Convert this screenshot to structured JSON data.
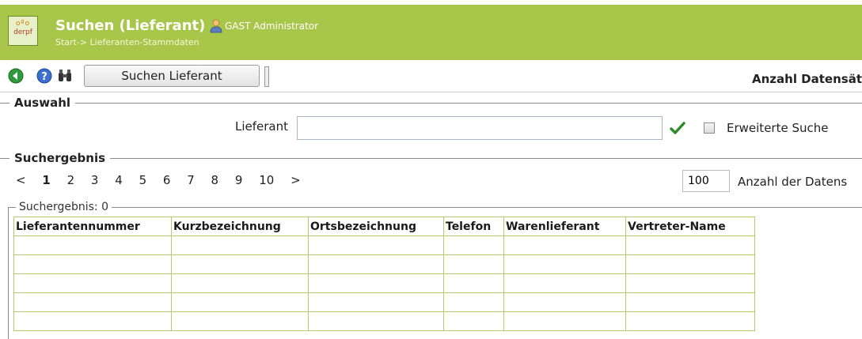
{
  "header": {
    "title": "Suchen (Lieferant)",
    "user": "GAST Administrator",
    "breadcrumb": "Start-> Lieferanten-Stammdaten",
    "logo_text": "derpf",
    "color": "#a8c64a"
  },
  "toolbar": {
    "icons": [
      "back-icon",
      "help-icon",
      "binoculars-icon"
    ],
    "search_button": "Suchen Lieferant",
    "count_label": "Anzahl Datensät"
  },
  "auswahl": {
    "title": "Auswahl",
    "field_label": "Lieferant",
    "field_value": "",
    "extended_label": "Erweiterte Suche",
    "extended_checked": false
  },
  "suchergebnis": {
    "title": "Suchergebnis",
    "pager": {
      "prev": "<",
      "pages": [
        "1",
        "2",
        "3",
        "4",
        "5",
        "6",
        "7",
        "8",
        "9",
        "10"
      ],
      "current": "1",
      "next": ">"
    },
    "per_page_value": "100",
    "per_page_label": "Anzahl der Datens",
    "results_legend": "Suchergebnis: 0",
    "columns": [
      "Lieferantennummer",
      "Kurzbezeichnung",
      "Ortsbezeichnung",
      "Telefon",
      "Warenlieferant",
      "Vertreter-Name"
    ],
    "rows": [
      [
        "",
        "",
        "",
        "",
        "",
        ""
      ],
      [
        "",
        "",
        "",
        "",
        "",
        ""
      ],
      [
        "",
        "",
        "",
        "",
        "",
        ""
      ],
      [
        "",
        "",
        "",
        "",
        "",
        ""
      ],
      [
        "",
        "",
        "",
        "",
        "",
        ""
      ]
    ]
  }
}
